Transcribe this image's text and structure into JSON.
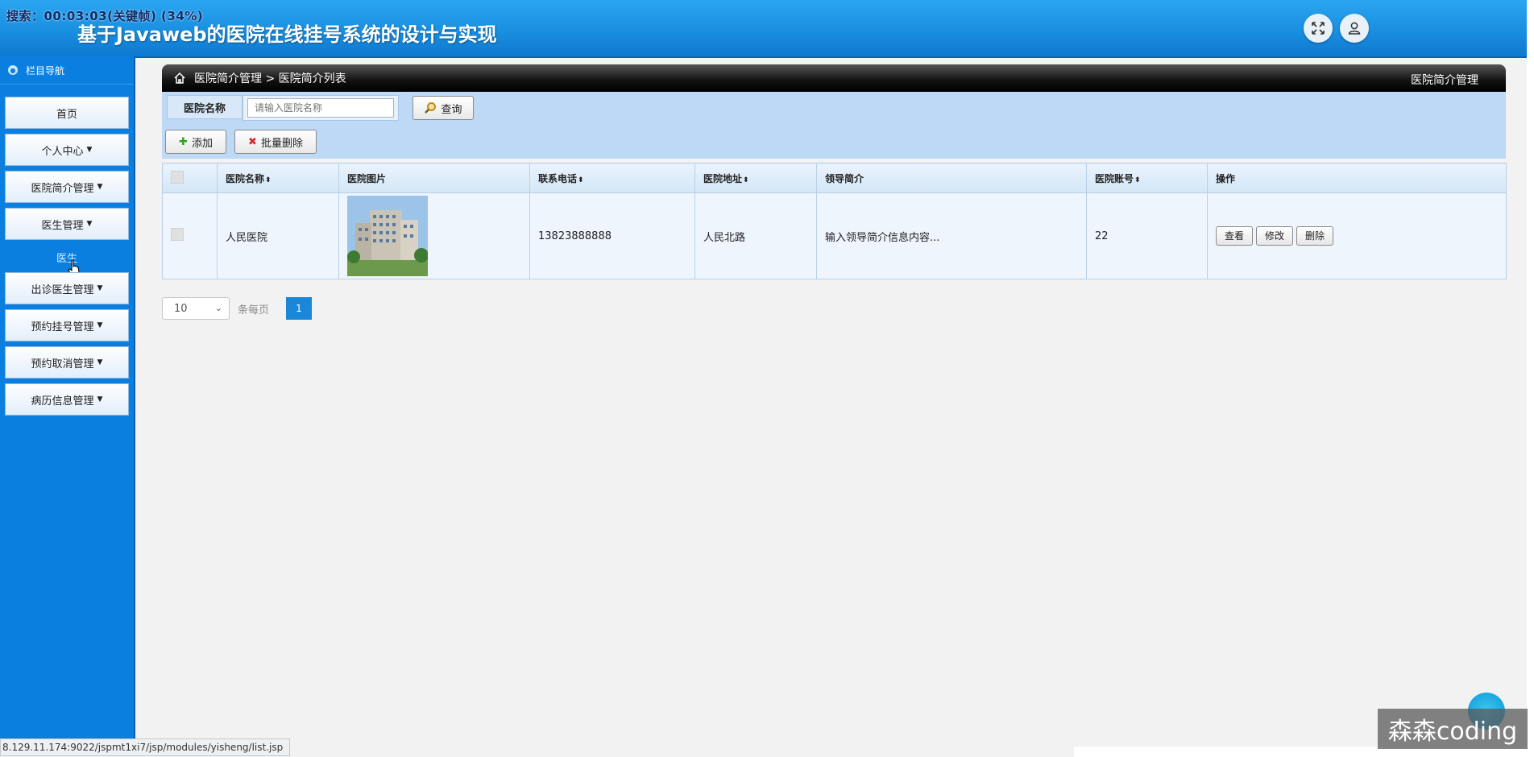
{
  "header": {
    "overlay_text": "搜索：00:03:03(关键帧) (34%)",
    "title": "基于Javaweb的医院在线挂号系统的设计与实现",
    "fullscreen_icon": "fullscreen-icon",
    "user_icon": "user-icon"
  },
  "sidebar": {
    "heading": "栏目导航",
    "items": [
      {
        "label": "首页",
        "caret": false
      },
      {
        "label": "个人中心",
        "caret": true
      },
      {
        "label": "医院简介管理",
        "caret": true
      },
      {
        "label": "医生管理",
        "caret": true
      },
      {
        "label": "出诊医生管理",
        "caret": true
      },
      {
        "label": "预约挂号管理",
        "caret": true
      },
      {
        "label": "预约取消管理",
        "caret": true
      },
      {
        "label": "病历信息管理",
        "caret": true
      }
    ],
    "sub_item": "医生"
  },
  "breadcrumb": {
    "path": "医院简介管理 > 医院简介列表",
    "right": "医院简介管理"
  },
  "search": {
    "label": "医院名称",
    "placeholder": "请输入医院名称",
    "query_button": "查询",
    "add_button": "添加",
    "batch_delete_button": "批量删除"
  },
  "table": {
    "columns": [
      "",
      "医院名称",
      "医院图片",
      "联系电话",
      "医院地址",
      "领导简介",
      "医院账号",
      "操作"
    ],
    "rows": [
      {
        "name": "人民医院",
        "phone": "13823888888",
        "address": "人民北路",
        "intro": "输入领导简介信息内容...",
        "account": "22",
        "actions": [
          "查看",
          "修改",
          "删除"
        ]
      }
    ]
  },
  "pagination": {
    "page_size": "10",
    "per_page_label": "条每页",
    "current_page": "1"
  },
  "status_url": "8.129.11.174:9022/jspmt1xi7/jsp/modules/yisheng/list.jsp",
  "watermark": "森森coding",
  "colors": {
    "header": "#1a8fe0",
    "sidebar": "#0a7fe0",
    "toolbar": "#bdd9f6",
    "page_active": "#1a87d9"
  }
}
